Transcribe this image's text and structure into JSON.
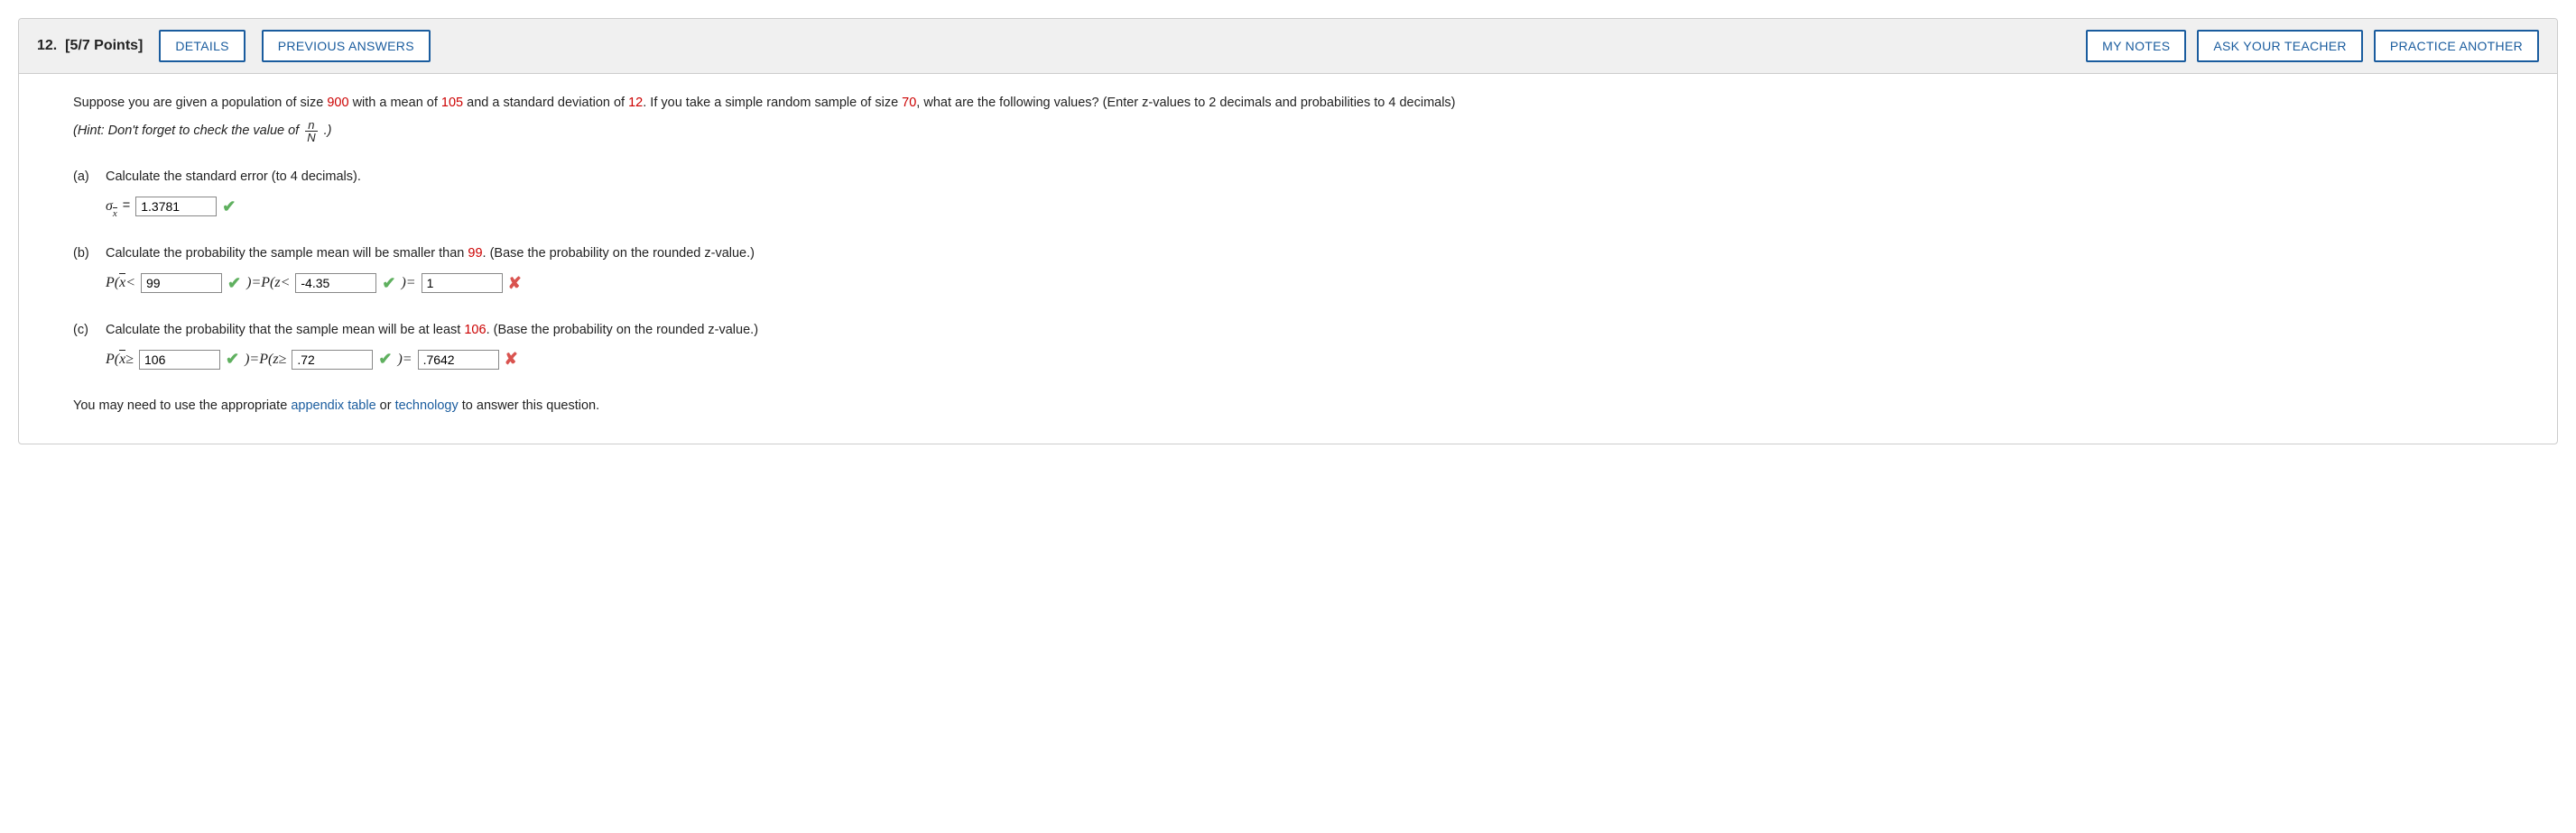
{
  "header": {
    "question_number": "12.",
    "points": "[5/7 Points]",
    "buttons": {
      "details": "DETAILS",
      "previous_answers": "PREVIOUS ANSWERS",
      "my_notes": "MY NOTES",
      "ask_teacher": "ASK YOUR TEACHER",
      "practice_another": "PRACTICE ANOTHER"
    }
  },
  "intro": {
    "pre1": "Suppose you are given a population of size ",
    "v1": "900",
    "mid1": " with a mean of ",
    "v2": "105",
    "mid2": " and a standard deviation of ",
    "v3": "12",
    "mid3": ". If you take a simple random sample of size ",
    "v4": "70",
    "post": ", what are the following values? (Enter z-values to 2 decimals and probabilities to 4 decimals)"
  },
  "hint": {
    "pre": "(Hint: Don't forget to check the value of ",
    "num": "n",
    "den": "N",
    "post": ".)"
  },
  "parts": {
    "a": {
      "label": "(a)",
      "question": "Calculate the standard error (to 4 decimals).",
      "sigma_sub": "x",
      "eq": "=",
      "value": "1.3781"
    },
    "b": {
      "label": "(b)",
      "q_pre": "Calculate the probability the sample mean will be smaller than ",
      "q_val": "99",
      "q_post": ". (Base the probability on the rounded z-value.)",
      "p_label": "P",
      "xbar": "x",
      "lt": "<",
      "val1": "99",
      "mid1": ")=",
      "pz": "P",
      "z": "z",
      "val2": "-4.35",
      "mid2": ")=",
      "val3": "1"
    },
    "c": {
      "label": "(c)",
      "q_pre": "Calculate the probability that the sample mean will be at least ",
      "q_val": "106",
      "q_post": ". (Base the probability on the rounded z-value.)",
      "p_label": "P",
      "xbar": "x",
      "ge": "≥",
      "val1": "106",
      "mid1": ")=",
      "pz": "P",
      "z": "z",
      "val2": ".72",
      "mid2": ")=",
      "val3": ".7642"
    }
  },
  "footer": {
    "pre": "You may need to use the appropriate ",
    "link1": "appendix table",
    "mid": " or ",
    "link2": "technology",
    "post": " to answer this question."
  }
}
